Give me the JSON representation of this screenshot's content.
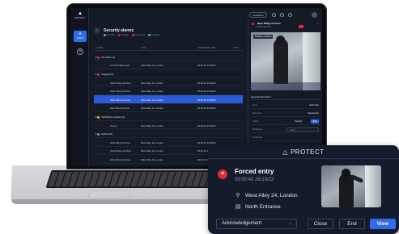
{
  "app": {
    "brand": "PROTECT",
    "rail": {
      "alarms_label": "Alarms"
    }
  },
  "alarms": {
    "title": "Security alarms",
    "legend": [
      {
        "label": "Any time",
        "color": "#8a94a8"
      },
      {
        "label": "Intrusion",
        "color": "#e02a3a"
      },
      {
        "label": "Connected",
        "color": "#e02a3a"
      },
      {
        "label": "All status",
        "color": "#3ac26b"
      }
    ],
    "columns": [
      "ALARM",
      "SITE",
      "TRIGGERED TIME",
      "TYPE"
    ],
    "rows": [
      {
        "kind": "group",
        "label": "Fire alarm (1)",
        "color": "#e02a3a",
        "site": "",
        "time": ""
      },
      {
        "kind": "row",
        "label": "1st Floor Basement",
        "site": "West Alley 24, London",
        "time": "20:40:24 22/10/23"
      },
      {
        "kind": "group",
        "label": "Ongoing (5)",
        "color": "#e02a3a",
        "site": "",
        "time": ""
      },
      {
        "kind": "row",
        "label": "South Wing 1st Floor",
        "site": "West Alley 24, London",
        "time": "20:40:24 22/10/23"
      },
      {
        "kind": "row",
        "label": "West Wing 1st Floor",
        "site": "West Alley 24, London",
        "time": "20:40:24 22/10/23"
      },
      {
        "kind": "sel",
        "label": "West Wing 1st Floor",
        "site": "West Alley 24, London",
        "time": "20:40:24 22/10/23"
      },
      {
        "kind": "row",
        "label": "East Wing 1st Floor",
        "site": "West Alley 24, London",
        "time": "20:40:24 22/10/23"
      },
      {
        "kind": "group",
        "label": "Verification required (1)",
        "color": "#f0b428",
        "site": "",
        "time": ""
      },
      {
        "kind": "row",
        "label": "Zone A",
        "site": "West Alley 24, London",
        "time": "20:40:24 22/10/23"
      },
      {
        "kind": "group",
        "label": "Ended (22)",
        "color": "#8a94a8",
        "site": "",
        "time": ""
      },
      {
        "kind": "row",
        "label": "West Wing 1st Floor",
        "site": "West Alley 24, London",
        "time": "20:40:24 22/10/23"
      },
      {
        "kind": "row",
        "label": "South Wing 1st Floor",
        "site": "West Alley 24, London",
        "time": "20:40:24 22/10/23"
      },
      {
        "kind": "row",
        "label": "West Wing 1st Floor",
        "site": "West Alley 24, London",
        "time": "20:40:24 22/10/23"
      }
    ]
  },
  "topbar": {
    "lockdown_label": "Lockdown"
  },
  "detail": {
    "title": "West Wing 1st Floor",
    "subtitle": "20:40:24 22/10/23",
    "image_tag": "Building 4 entrance",
    "section": "General information",
    "fields": [
      {
        "key": "Zone",
        "value": "Vault Gate"
      },
      {
        "key": "Detection",
        "value": "Appearance"
      },
      {
        "key": "Status",
        "value": "Ongoing"
      },
      {
        "key": "Verification",
        "value": "Select"
      },
      {
        "key": "Verified by",
        "value": ""
      }
    ],
    "status_end_label": "End"
  },
  "card": {
    "brand": "PROTECT",
    "title": "Forced entry",
    "time": "08:00:40 26/10/22",
    "location": "West Alley 24, London",
    "door": "North Entrance",
    "select_value": "Acknowledgement",
    "buttons": {
      "close": "Close",
      "end": "End",
      "view": "View"
    }
  }
}
